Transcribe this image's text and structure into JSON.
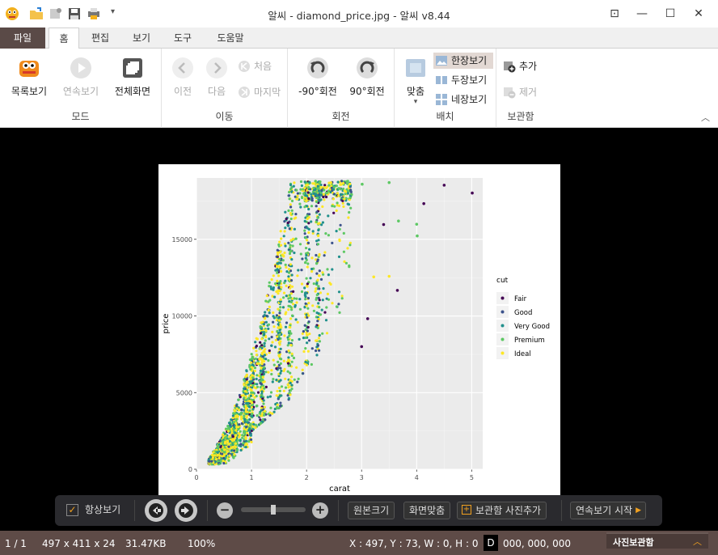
{
  "window": {
    "title": "알씨 - diamond_price.jpg - 알씨 v8.44"
  },
  "tabs": [
    "파일",
    "홈",
    "편집",
    "보기",
    "도구",
    "도움말"
  ],
  "ribbon": {
    "mode": {
      "label": "모드",
      "list": "목록보기",
      "slideshow": "연속보기",
      "fullscreen": "전체화면"
    },
    "move": {
      "label": "이동",
      "prev": "이전",
      "next": "다음",
      "first": "처음",
      "last": "마지막"
    },
    "rotate": {
      "label": "회전",
      "ccw": "-90°회전",
      "cw": "90°회전"
    },
    "layout": {
      "label": "배치",
      "fit": "맞춤",
      "one": "한장보기",
      "two": "두장보기",
      "four": "네장보기"
    },
    "album": {
      "label": "보관함",
      "add": "추가",
      "remove": "제거"
    }
  },
  "bottom": {
    "always_on_top": "항상보기",
    "original_size": "원본크기",
    "fit_screen": "화면맞춤",
    "add_to_album": "보관함 사진추가",
    "start_slideshow": "연속보기 시작",
    "zoom_slider_fraction": 0.5
  },
  "status": {
    "index": "1 / 1",
    "dims": "497 x 411 x 24",
    "size": "31.47KB",
    "zoom": "100%",
    "coords": "X : 497, Y : 73, W : 0, H : 0",
    "d_label": "D",
    "rgb": "000, 000, 000",
    "album_panel": "사진보관함"
  },
  "chart_data": {
    "type": "scatter",
    "xlabel": "carat",
    "ylabel": "price",
    "xlim": [
      0,
      5.2
    ],
    "ylim": [
      0,
      19000
    ],
    "xticks": [
      0,
      1,
      2,
      3,
      4,
      5
    ],
    "yticks": [
      0,
      5000,
      10000,
      15000
    ],
    "legend_title": "cut",
    "legend_position": "right",
    "series": [
      {
        "name": "Fair",
        "color": "#440154"
      },
      {
        "name": "Good",
        "color": "#3b528b"
      },
      {
        "name": "Very Good",
        "color": "#21908c"
      },
      {
        "name": "Premium",
        "color": "#5dc863"
      },
      {
        "name": "Ideal",
        "color": "#fde725"
      }
    ],
    "outliers": [
      {
        "x": 5.01,
        "y": 18018,
        "cut": "Fair"
      },
      {
        "x": 4.5,
        "y": 18531,
        "cut": "Fair"
      },
      {
        "x": 4.13,
        "y": 17329,
        "cut": "Fair"
      },
      {
        "x": 4.01,
        "y": 15223,
        "cut": "Premium"
      },
      {
        "x": 4.0,
        "y": 15984,
        "cut": "Premium"
      },
      {
        "x": 3.5,
        "y": 18701,
        "cut": "Premium"
      },
      {
        "x": 3.67,
        "y": 16193,
        "cut": "Premium"
      },
      {
        "x": 3.4,
        "y": 15964,
        "cut": "Fair"
      },
      {
        "x": 3.22,
        "y": 12545,
        "cut": "Ideal"
      },
      {
        "x": 3.65,
        "y": 11668,
        "cut": "Fair"
      },
      {
        "x": 3.5,
        "y": 12587,
        "cut": "Ideal"
      },
      {
        "x": 3.01,
        "y": 18593,
        "cut": "Premium"
      },
      {
        "x": 3.0,
        "y": 8000,
        "cut": "Fair"
      },
      {
        "x": 3.11,
        "y": 9823,
        "cut": "Fair"
      }
    ]
  }
}
